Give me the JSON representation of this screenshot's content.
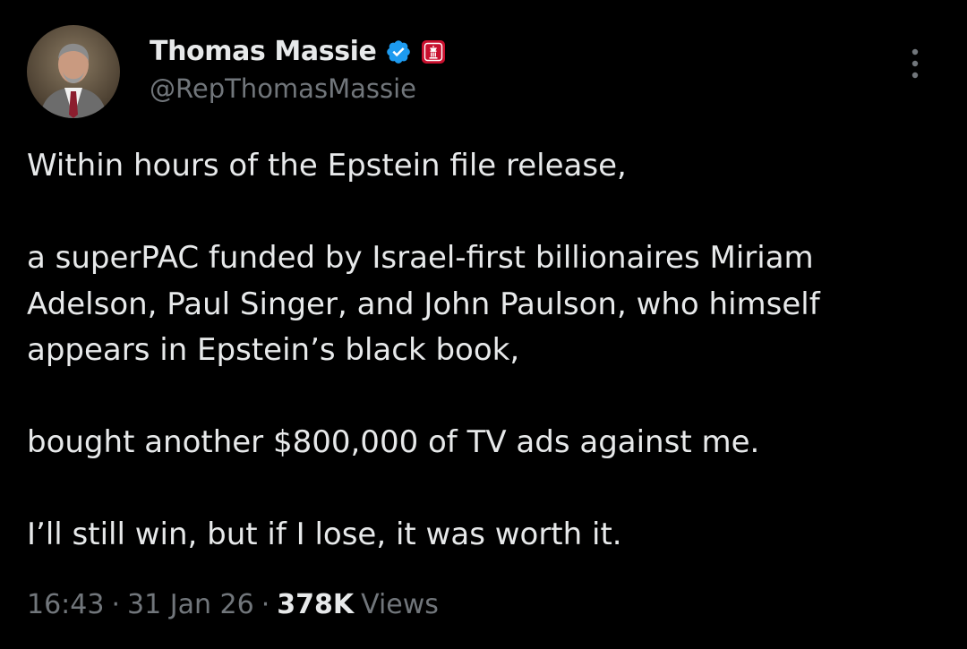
{
  "author": {
    "name": "Thomas Massie",
    "handle": "@RepThomasMassie",
    "verified_color": "#1d9bf0",
    "affiliation_badge_color": "#c8102e"
  },
  "tweet": {
    "paragraphs": [
      "Within hours of the Epstein file release,",
      "a superPAC funded by Israel-first billionaires Miriam Adelson, Paul Singer, and John Paulson, who himself appears in Epstein’s black book,",
      "bought another $800,000 of TV ads against me.",
      "I’ll still win, but if I lose, it was worth it."
    ]
  },
  "meta": {
    "time": "16:43",
    "sep1": "·",
    "date": "31 Jan 26",
    "sep2": "·",
    "views_count": "378K",
    "views_label": "Views"
  },
  "icons": {
    "verified": "verified-badge-icon",
    "affiliation": "house-seal-icon",
    "more": "more-options-icon"
  }
}
